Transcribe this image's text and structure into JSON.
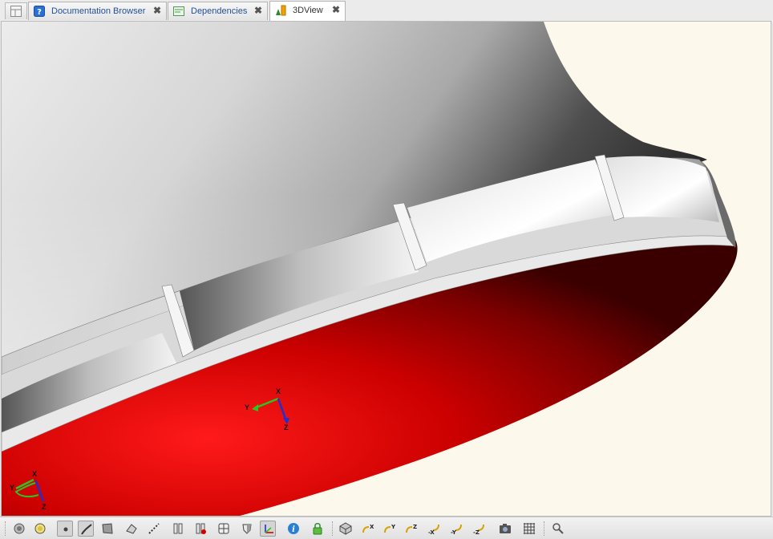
{
  "tabs": [
    {
      "label": "Documentation Browser",
      "icon": "help-icon",
      "close": "✖"
    },
    {
      "label": "Dependencies",
      "icon": "dependencies-icon",
      "close": "✖"
    },
    {
      "label": "3DView",
      "icon": "3dview-icon",
      "close": "✖"
    }
  ],
  "active_tab": "3DView",
  "axes": {
    "x": "X",
    "y": "Y",
    "z": "Z"
  },
  "colors": {
    "background": "#fdf8ec",
    "face_red": "#e80000",
    "shell": "#b0b0b0",
    "x_axis": "#d40000",
    "y_axis": "#2ec41f",
    "z_axis": "#1f2fd0"
  },
  "toolbar": {
    "buttons": [
      {
        "icon": "shaded-icon",
        "glyph": ""
      },
      {
        "icon": "shaded-with-edges-icon",
        "glyph": ""
      },
      {
        "icon": "vertex-icon",
        "glyph": "",
        "pressed": true
      },
      {
        "icon": "edge-icon",
        "glyph": "",
        "pressed": true
      },
      {
        "icon": "face-icon",
        "glyph": ""
      },
      {
        "icon": "solid-icon",
        "glyph": ""
      },
      {
        "icon": "dashed-line-icon",
        "glyph": ""
      },
      {
        "icon": "section-icon",
        "glyph": ""
      },
      {
        "icon": "section-clear-icon",
        "glyph": ""
      },
      {
        "icon": "explode-icon",
        "glyph": ""
      },
      {
        "icon": "shield-icon",
        "glyph": ""
      },
      {
        "icon": "trihedron-icon",
        "glyph": "",
        "pressed": true
      },
      {
        "icon": "info-icon",
        "glyph": "i"
      },
      {
        "icon": "lock-icon",
        "glyph": ""
      },
      {
        "icon": "iso-view-icon",
        "glyph": ""
      },
      {
        "icon": "view-x-icon",
        "glyph": "X"
      },
      {
        "icon": "view-y-icon",
        "glyph": "Y"
      },
      {
        "icon": "view-z-icon",
        "glyph": "Z"
      },
      {
        "icon": "view-minus-x-icon",
        "glyph": "-X"
      },
      {
        "icon": "view-minus-y-icon",
        "glyph": "-Y"
      },
      {
        "icon": "view-minus-z-icon",
        "glyph": "-Z"
      },
      {
        "icon": "camera-icon",
        "glyph": ""
      },
      {
        "icon": "grid-icon",
        "glyph": ""
      },
      {
        "icon": "zoom-icon",
        "glyph": ""
      }
    ]
  }
}
